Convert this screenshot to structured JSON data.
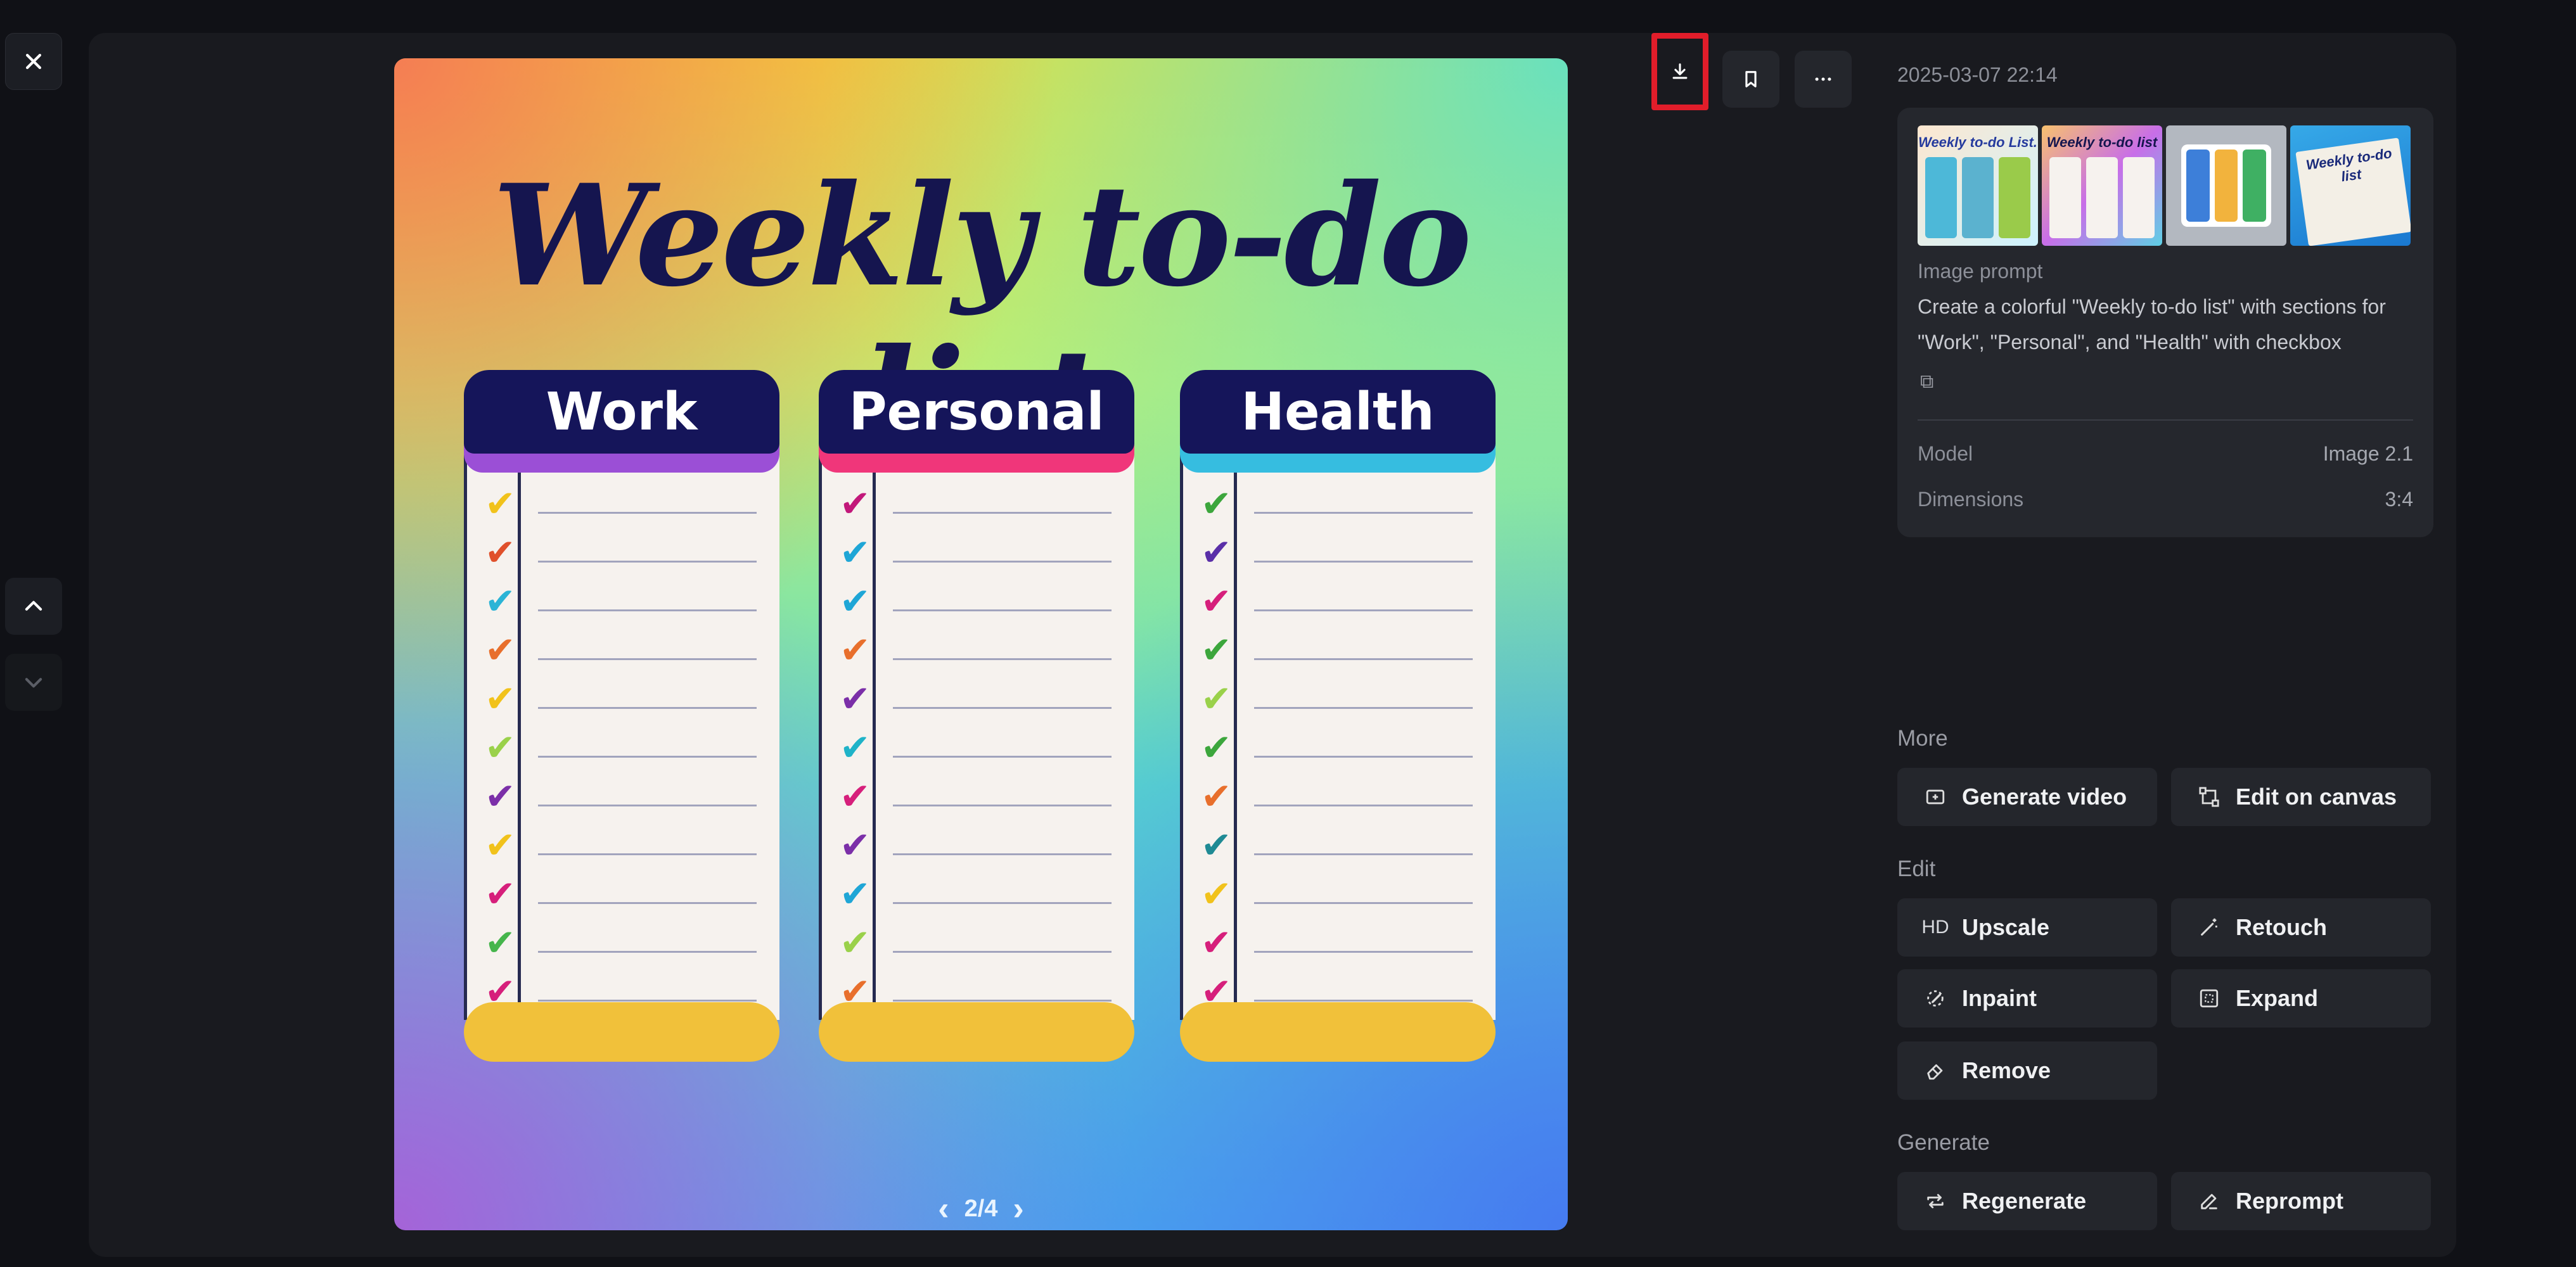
{
  "viewer": {
    "close_label": "✕",
    "nav_up": "⌃",
    "nav_down": "⌄",
    "image": {
      "title": "Weekly to-do list",
      "columns": [
        {
          "label": "Work",
          "band_color": "#9b4fd6",
          "check_colors": [
            "#f1c21b",
            "#e0502b",
            "#2bb4d6",
            "#e86f2c",
            "#f1c21b",
            "#9ad14a",
            "#7b2fa8",
            "#f1c21b",
            "#d61f7b",
            "#45b54b",
            "#d61f7b"
          ]
        },
        {
          "label": "Personal",
          "band_color": "#f0367a",
          "check_colors": [
            "#c2187a",
            "#1fa6d6",
            "#1fa6d6",
            "#e86f2c",
            "#7b2fa8",
            "#1fb3c8",
            "#d61f7b",
            "#7b2fa8",
            "#1fa6d6",
            "#9ad14a",
            "#e86f2c"
          ]
        },
        {
          "label": "Health",
          "band_color": "#36bde0",
          "check_colors": [
            "#3ca63c",
            "#5a2fa8",
            "#d61f7b",
            "#3ca63c",
            "#9ad14a",
            "#3ca63c",
            "#e86f2c",
            "#1f8a94",
            "#f1c21b",
            "#d61f7b",
            "#d61f7b"
          ]
        }
      ],
      "pager": {
        "prev": "‹",
        "text": "2/4",
        "next": "›"
      }
    },
    "actions": {
      "download_icon": "download-icon",
      "bookmark_icon": "bookmark-icon",
      "more_icon": "more-icon"
    }
  },
  "side": {
    "date": "2025-03-07 22:14",
    "thumbnails": [
      {
        "title": "Weekly to-do List."
      },
      {
        "title": "Weekly to-do list"
      },
      {
        "title": ""
      },
      {
        "title": "Weekly to-do list"
      }
    ],
    "prompt_label": "Image prompt",
    "prompt_text": "Create a colorful \"Weekly to-do list\" with sections for \"Work\", \"Personal\", and \"Health\" with checkbox",
    "copy_icon": "⧉",
    "model_label": "Model",
    "model_value": "Image 2.1",
    "dimensions_label": "Dimensions",
    "dimensions_value": "3:4",
    "more_label": "More",
    "generate_video": "Generate video",
    "edit_canvas": "Edit on canvas",
    "edit_label": "Edit",
    "hd_badge": "HD",
    "upscale": "Upscale",
    "retouch": "Retouch",
    "inpaint": "Inpaint",
    "expand": "Expand",
    "remove": "Remove",
    "generate_label": "Generate",
    "regenerate": "Regenerate",
    "reprompt": "Reprompt"
  }
}
